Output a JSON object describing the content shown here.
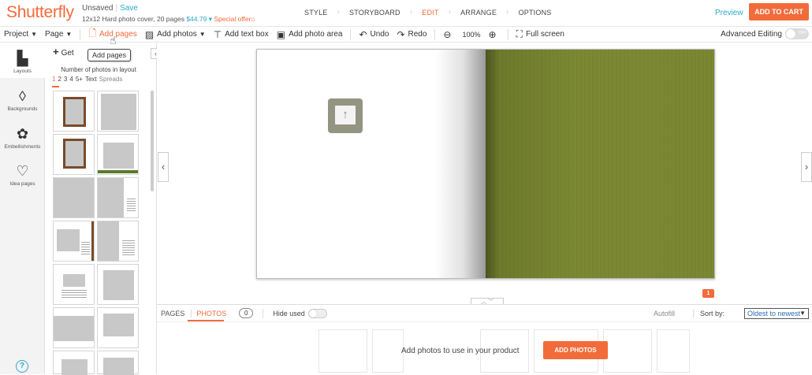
{
  "header": {
    "logo": "Shutterfly",
    "status_unsaved": "Unsaved",
    "status_save": "Save",
    "project_desc": "12x12 Hard photo cover, 20 pages",
    "price": "$44.79",
    "special_offer": "Special offer",
    "steps": [
      "STYLE",
      "STORYBOARD",
      "EDIT",
      "ARRANGE",
      "OPTIONS"
    ],
    "active_step": "EDIT",
    "preview": "Preview",
    "add_to_cart": "ADD TO CART"
  },
  "toolbar": {
    "project": "Project",
    "page": "Page",
    "add_pages": "Add pages",
    "add_photos": "Add photos",
    "add_text_box": "Add text box",
    "add_photo_area": "Add photo area",
    "undo": "Undo",
    "redo": "Redo",
    "zoom": "100%",
    "full_screen": "Full screen",
    "advanced_editing": "Advanced Editing",
    "toggle_state": "OFF"
  },
  "tooltip": "Add pages",
  "rail": {
    "items": [
      {
        "label": "Layouts",
        "icon": "layouts-icon"
      },
      {
        "label": "Backgrounds",
        "icon": "droplet-icon"
      },
      {
        "label": "Embellishments",
        "icon": "flower-icon"
      },
      {
        "label": "Idea pages",
        "icon": "lightbulb-icon"
      }
    ]
  },
  "panel": {
    "get_button": "Get",
    "num_label": "Number of photos in layout",
    "filters": [
      "1",
      "2",
      "3",
      "4",
      "5+",
      "Text",
      "Spreads"
    ],
    "active_filter": "1"
  },
  "canvas": {
    "page_badge": "1"
  },
  "tray": {
    "tab_pages": "PAGES",
    "tab_photos": "PHOTOS",
    "photo_count": "0",
    "hide_used": "Hide used",
    "autofill": "Autofill",
    "sort_label": "Sort by:",
    "sort_value": "Oldest to newest",
    "message": "Add photos to use in your product",
    "add_photos_button": "ADD PHOTOS"
  },
  "colors": {
    "accent": "#f26b3a",
    "link": "#2aa9c7",
    "background_green": "#7b8731"
  }
}
